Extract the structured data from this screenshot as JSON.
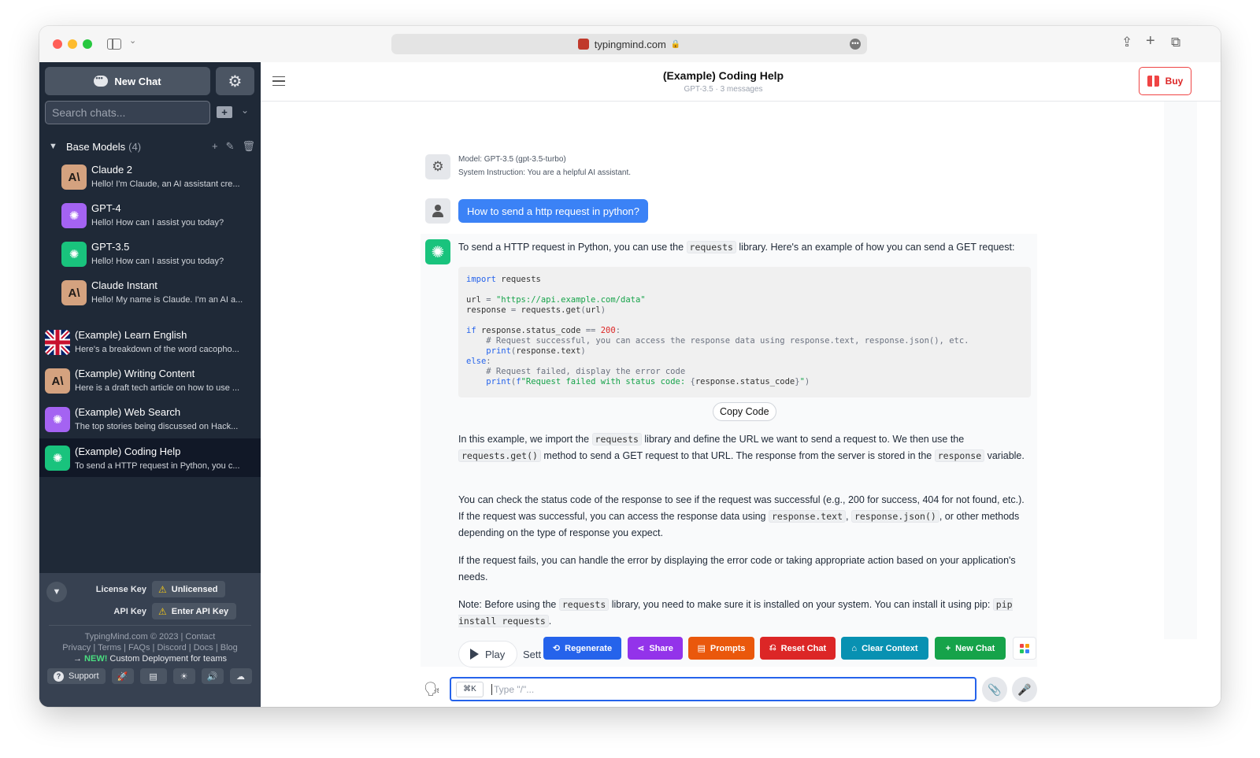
{
  "browser": {
    "url": "typingmind.com"
  },
  "sidebar": {
    "new_chat_label": "New Chat",
    "search_placeholder": "Search chats...",
    "group": {
      "title": "Base Models",
      "count": "(4)",
      "items": [
        {
          "title": "Claude 2",
          "preview": "Hello! I'm Claude, an AI assistant cre...",
          "avatar": "AI"
        },
        {
          "title": "GPT-4",
          "preview": "Hello! How can I assist you today?",
          "avatar": "openai-icon"
        },
        {
          "title": "GPT-3.5",
          "preview": "Hello! How can I assist you today?",
          "avatar": "openai-icon"
        },
        {
          "title": "Claude Instant",
          "preview": "Hello! My name is Claude. I'm an AI a...",
          "avatar": "AI"
        }
      ]
    },
    "chats": [
      {
        "title": "(Example) Learn English",
        "preview": "Here's a breakdown of the word cacopho...",
        "avatar": "uk-flag-icon"
      },
      {
        "title": "(Example) Writing Content",
        "preview": "Here is a draft tech article on how to use ...",
        "avatar": "AI"
      },
      {
        "title": "(Example) Web Search",
        "preview": "The top stories being discussed on Hack...",
        "avatar": "openai-icon"
      },
      {
        "title": "(Example) Coding Help",
        "preview": "To send a HTTP request in Python, you c...",
        "avatar": "openai-icon"
      }
    ],
    "footer": {
      "license_label": "License Key",
      "license_value": "Unlicensed",
      "api_label": "API Key",
      "api_value": "Enter API Key",
      "line1": "TypingMind.com © 2023 | Contact",
      "line2": "Privacy | Terms | FAQs | Discord | Docs | Blog",
      "line3_prefix": "→ ",
      "line3_new": "NEW!",
      "line3_rest": " Custom Deployment for teams",
      "support_label": "Support"
    }
  },
  "header": {
    "title": "(Example) Coding Help",
    "subtitle": "GPT-3.5 · 3 messages",
    "buy_label": "Buy"
  },
  "messages": {
    "system_model": "Model: GPT-3.5 (gpt-3.5-turbo)",
    "system_instruction": "System Instruction: You are a helpful AI assistant.",
    "user_text": "How to send a http request in python?",
    "intro_a": "To send a HTTP request in Python, you can use the ",
    "intro_code": "requests",
    "intro_b": " library. Here's an example of how you can send a GET request:",
    "copy_code_label": "Copy Code",
    "p2_a": "In this example, we import the ",
    "p2_code1": "requests",
    "p2_b": " library and define the URL we want to send a request to. We then use the ",
    "p2_code2": "requests.get()",
    "p2_c": " method to send a GET request to that URL. The response from the server is stored in the ",
    "p2_code3": "response",
    "p2_d": " variable.",
    "p3_a": "You can check the status code of the response to see if the request was successful (e.g., 200 for success, 404 for not found, etc.). If the request was successful, you can access the response data using ",
    "p3_code1": "response.text",
    "p3_b": ", ",
    "p3_code2": "response.json()",
    "p3_c": ", or other methods depending on the type of response you expect.",
    "p4": "If the request fails, you can handle the error by displaying the error code or taking appropriate action based on your application's needs.",
    "p5_a": "Note: Before using the ",
    "p5_code1": "requests",
    "p5_b": " library, you need to make sure it is installed on your system. You can install it using pip: ",
    "p5_code2": "pip install requests",
    "p5_c": "."
  },
  "actions": {
    "play": "Play",
    "sett": "Sett",
    "regenerate": "Regenerate",
    "share": "Share",
    "prompts": "Prompts",
    "reset_chat": "Reset Chat",
    "clear_context": "Clear Context",
    "new_chat": "New Chat"
  },
  "input": {
    "shortcut": "⌘K",
    "placeholder": "Type \"/\"..."
  },
  "colors": {
    "sidebar_bg": "#1f2937",
    "accent_blue": "#3b82f6",
    "gpt_green": "#19c37d",
    "gpt4_purple": "#a463f2",
    "claude_tan": "#d4a27f"
  }
}
